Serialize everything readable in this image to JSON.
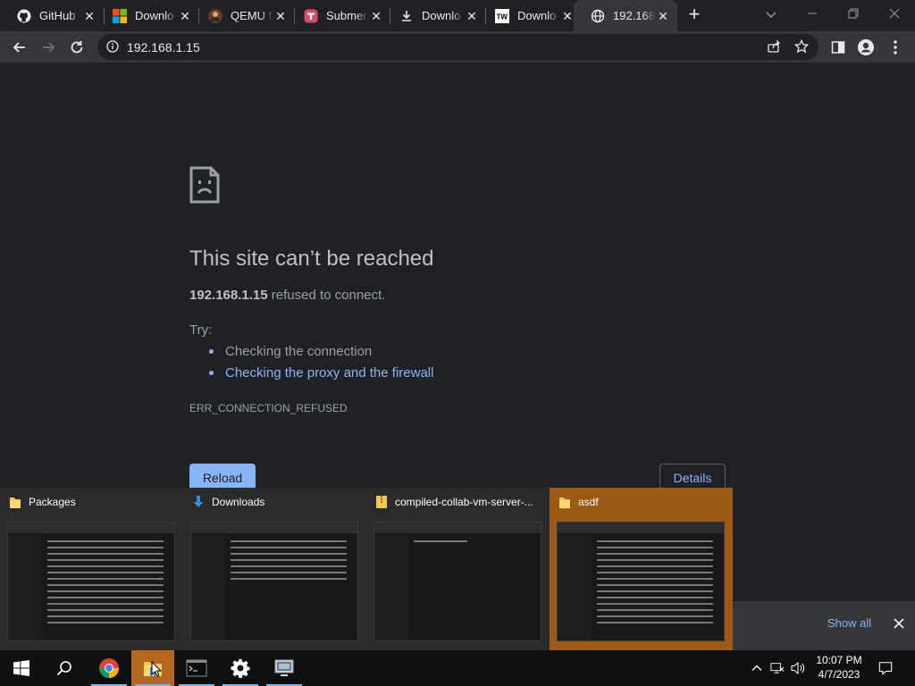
{
  "browser": {
    "tabs": [
      {
        "title": "GitHub",
        "icon": "github-icon"
      },
      {
        "title": "Downlo",
        "icon": "microsoft-icon"
      },
      {
        "title": "QEMU f",
        "icon": "avatar-icon"
      },
      {
        "title": "Submen",
        "icon": "app-icon"
      },
      {
        "title": "Downlo",
        "icon": "download-icon"
      },
      {
        "title": "Downlo",
        "icon": "tw-icon"
      },
      {
        "title": "192.168",
        "icon": "globe-icon",
        "active": true
      }
    ],
    "close_glyph": "✕",
    "new_tab_glyph": "+",
    "url": "192.168.1.15"
  },
  "error_page": {
    "title": "This site can’t be reached",
    "host": "192.168.1.15",
    "desc_suffix": " refused to connect.",
    "try_label": "Try:",
    "suggestions": [
      {
        "text": "Checking the connection",
        "link": false
      },
      {
        "text": "Checking the proxy and the firewall",
        "link": true
      }
    ],
    "error_code": "ERR_CONNECTION_REFUSED",
    "reload_label": "Reload",
    "details_label": "Details"
  },
  "download_bar": {
    "show_all": "Show all"
  },
  "taskbar_preview": {
    "windows": [
      {
        "title": "Packages",
        "icon": "folder-icon"
      },
      {
        "title": "Downloads",
        "icon": "download-arrow-icon"
      },
      {
        "title": "compiled-collab-vm-server-...",
        "icon": "zip-folder-icon"
      },
      {
        "title": "asdf",
        "icon": "folder-icon",
        "selected": true
      }
    ]
  },
  "taskbar": {
    "time": "10:07 PM",
    "date": "4/7/2023"
  },
  "colors": {
    "accent": "#8ab4f8",
    "selected_thumb": "#9b5a16",
    "taskbar_active": "#b5671d"
  }
}
